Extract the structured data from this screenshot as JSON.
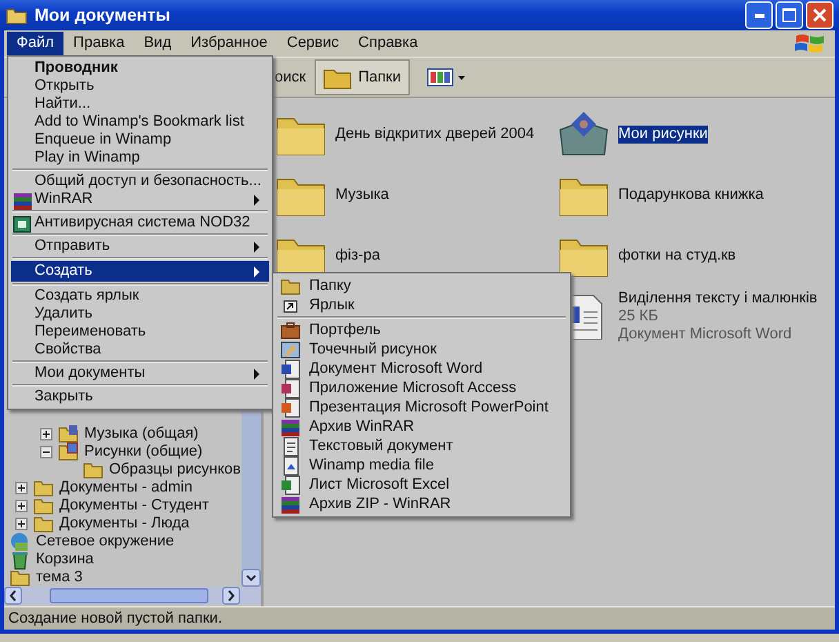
{
  "window": {
    "title": "Мои документы"
  },
  "menubar": [
    {
      "label": "Файл",
      "selected": true
    },
    {
      "label": "Правка",
      "selected": false
    },
    {
      "label": "Вид",
      "selected": false
    },
    {
      "label": "Избранное",
      "selected": false
    },
    {
      "label": "Сервис",
      "selected": false
    },
    {
      "label": "Справка",
      "selected": false
    }
  ],
  "toolbar": {
    "search_label": "оиск",
    "folders_button": {
      "label": "Папки",
      "pressed": true
    }
  },
  "file_menu": [
    {
      "kind": "item",
      "label": "Проводник",
      "default": true,
      "submenu": false,
      "selected": false
    },
    {
      "kind": "item",
      "label": "Открыть",
      "default": false,
      "submenu": false,
      "selected": false
    },
    {
      "kind": "item",
      "label": "Найти...",
      "default": false,
      "submenu": false,
      "selected": false
    },
    {
      "kind": "item",
      "label": "Add to Winamp's Bookmark list",
      "default": false,
      "submenu": false,
      "selected": false
    },
    {
      "kind": "item",
      "label": "Enqueue in Winamp",
      "default": false,
      "submenu": false,
      "selected": false
    },
    {
      "kind": "item",
      "label": "Play in Winamp",
      "default": false,
      "submenu": false,
      "selected": false
    },
    {
      "kind": "separator"
    },
    {
      "kind": "item",
      "label": "Общий доступ и безопасность...",
      "default": false,
      "submenu": false,
      "selected": false
    },
    {
      "kind": "archive",
      "label": "WinRAR",
      "default": false,
      "submenu": true,
      "selected": false
    },
    {
      "kind": "separator"
    },
    {
      "kind": "antivirus",
      "label": "Антивирусная система NOD32",
      "default": false,
      "submenu": false,
      "selected": false
    },
    {
      "kind": "separator"
    },
    {
      "kind": "item",
      "label": "Отправить",
      "default": false,
      "submenu": true,
      "selected": false
    },
    {
      "kind": "separator"
    },
    {
      "kind": "item",
      "label": "Создать",
      "default": false,
      "submenu": true,
      "selected": true
    },
    {
      "kind": "separator"
    },
    {
      "kind": "item",
      "label": "Создать ярлык",
      "default": false,
      "submenu": false,
      "selected": false
    },
    {
      "kind": "item",
      "label": "Удалить",
      "default": false,
      "submenu": false,
      "selected": false
    },
    {
      "kind": "item",
      "label": "Переименовать",
      "default": false,
      "submenu": false,
      "selected": false
    },
    {
      "kind": "item",
      "label": "Свойства",
      "default": false,
      "submenu": false,
      "selected": false
    },
    {
      "kind": "separator"
    },
    {
      "kind": "item",
      "label": "Мои документы",
      "default": false,
      "submenu": true,
      "selected": false
    },
    {
      "kind": "separator"
    },
    {
      "kind": "item",
      "label": "Закрыть",
      "default": false,
      "submenu": false,
      "selected": false
    }
  ],
  "create_submenu": [
    {
      "kind": "folder",
      "label": "Папку"
    },
    {
      "kind": "shortcut",
      "label": "Ярлык"
    },
    {
      "kind": "separator"
    },
    {
      "kind": "briefcase",
      "label": "Портфель"
    },
    {
      "kind": "bitmap",
      "label": "Точечный рисунок"
    },
    {
      "kind": "word",
      "label": "Документ Microsoft Word"
    },
    {
      "kind": "access",
      "label": "Приложение Microsoft Access"
    },
    {
      "kind": "powerpoint",
      "label": "Презентация Microsoft PowerPoint"
    },
    {
      "kind": "archive",
      "label": "Архив WinRAR"
    },
    {
      "kind": "text",
      "label": "Текстовый документ"
    },
    {
      "kind": "media",
      "label": "Winamp media file"
    },
    {
      "kind": "excel",
      "label": "Лист Microsoft Excel"
    },
    {
      "kind": "archive",
      "label": "Архив ZIP - WinRAR"
    }
  ],
  "tree": [
    {
      "children": [
        {
          "children": [
            {
              "label": "Музыка (общая)",
              "kind": "music",
              "expanded": false
            },
            {
              "label": "Рисунки (общие)",
              "kind": "pictures",
              "expanded": true,
              "children": [
                {
                  "label": "Образцы рисунков",
                  "kind": "folder"
                }
              ]
            }
          ]
        },
        {
          "label": "Документы - admin",
          "kind": "folder",
          "expanded": false
        },
        {
          "label": "Документы - Студент",
          "kind": "folder",
          "expanded": false
        },
        {
          "label": "Документы - Люда",
          "kind": "folder",
          "expanded": false
        }
      ]
    },
    {
      "label": "Сетевое окружение",
      "kind": "network"
    },
    {
      "label": "Корзина",
      "kind": "recycle"
    },
    {
      "label": "тема 3",
      "kind": "folder"
    }
  ],
  "files": [
    {
      "label": "День відкритих дверей 2004",
      "kind": "folder",
      "selected": false
    },
    {
      "label": "Мои рисунки",
      "kind": "pictures",
      "selected": true
    },
    {
      "label": "Музыка",
      "kind": "folder",
      "selected": false
    },
    {
      "label": "Подарункова книжка",
      "kind": "folder",
      "selected": false
    },
    {
      "label": "фіз-ра",
      "kind": "folder",
      "selected": false
    },
    {
      "label": "фотки на студ.кв",
      "kind": "folder",
      "selected": false
    },
    {
      "label": "Виділення тексту і малюнків",
      "kind": "word",
      "selected": false,
      "details": [
        "25 КБ",
        "Документ Microsoft Word"
      ]
    }
  ],
  "status_bar": {
    "text": "Создание новой пустой папки."
  }
}
